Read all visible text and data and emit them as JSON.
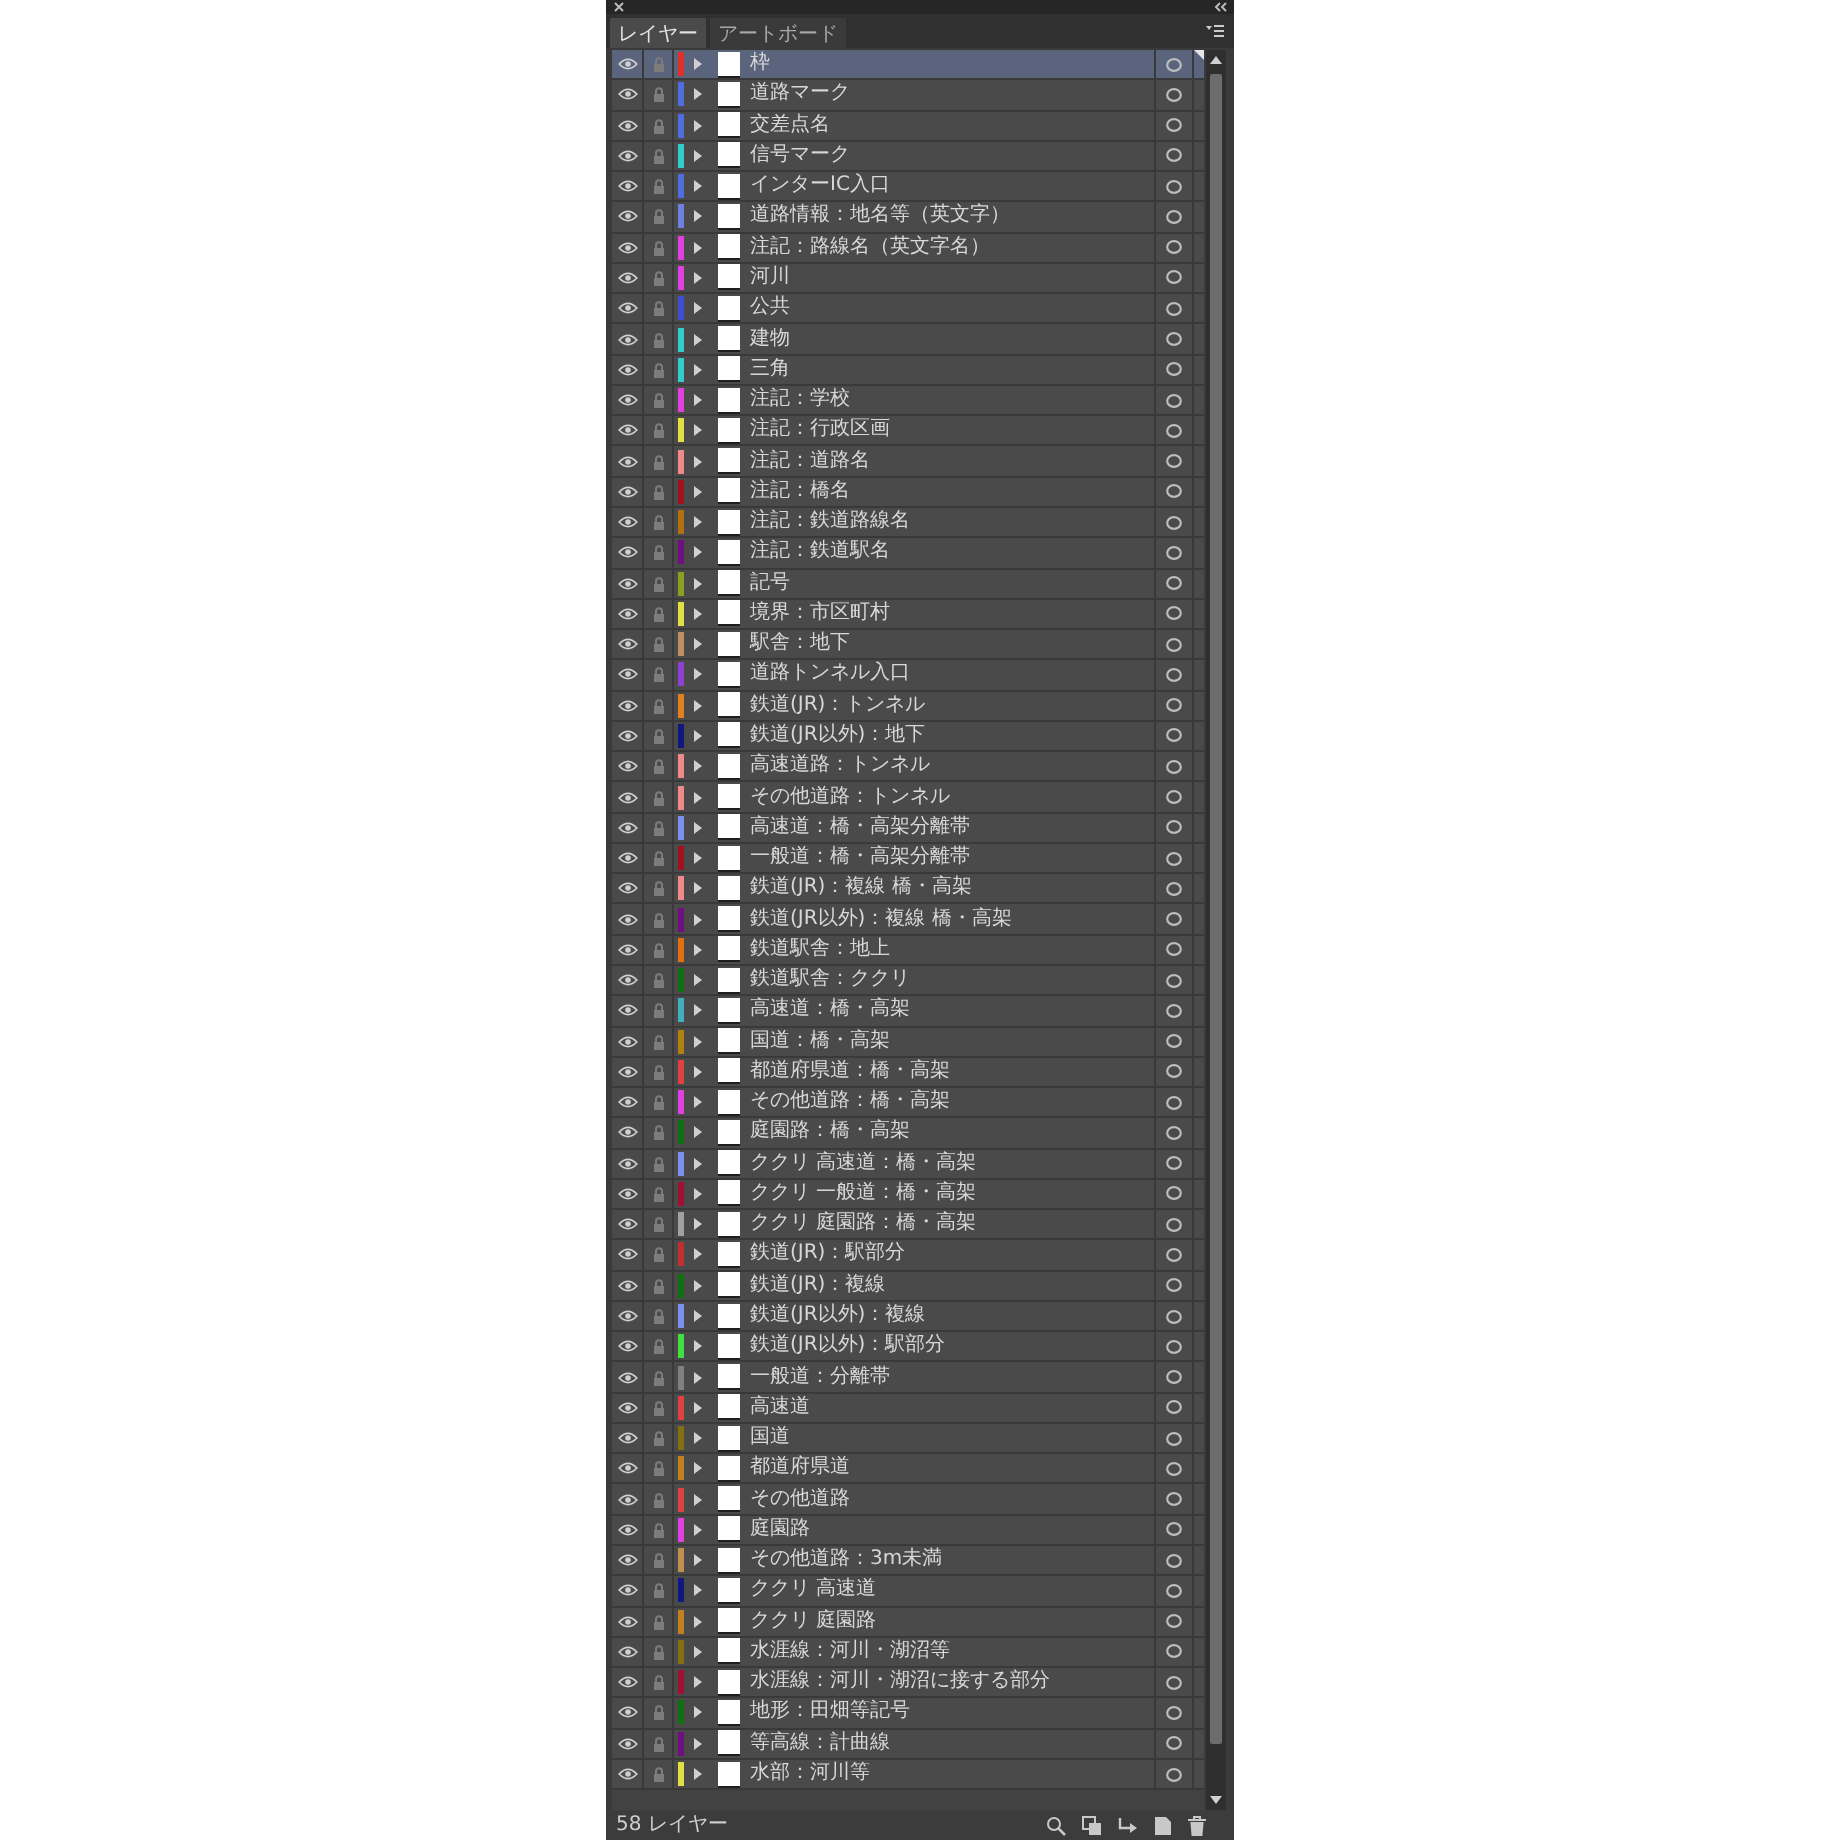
{
  "tabs": [
    {
      "label": "レイヤー",
      "selected": true
    },
    {
      "label": "アートボード",
      "selected": false
    }
  ],
  "layers": [
    {
      "name": "枠",
      "color": "#e0302c",
      "selected": true,
      "visible": true,
      "locked": true,
      "expanded": false
    },
    {
      "name": "道路マーク",
      "color": "#4f6ee0",
      "selected": false,
      "visible": true,
      "locked": true,
      "expanded": false
    },
    {
      "name": "交差点名",
      "color": "#4f6ee0",
      "selected": false,
      "visible": true,
      "locked": true,
      "expanded": false
    },
    {
      "name": "信号マーク",
      "color": "#33cccc",
      "selected": false,
      "visible": true,
      "locked": true,
      "expanded": false
    },
    {
      "name": "インターIC入口",
      "color": "#4f6ee0",
      "selected": false,
      "visible": true,
      "locked": true,
      "expanded": false
    },
    {
      "name": "道路情報：地名等（英文字）",
      "color": "#7080e0",
      "selected": false,
      "visible": true,
      "locked": true,
      "expanded": false
    },
    {
      "name": "注記：路線名（英文字名）",
      "color": "#e040e0",
      "selected": false,
      "visible": true,
      "locked": true,
      "expanded": false
    },
    {
      "name": "河川",
      "color": "#e040e0",
      "selected": false,
      "visible": true,
      "locked": true,
      "expanded": false
    },
    {
      "name": "公共",
      "color": "#3d4ed0",
      "selected": false,
      "visible": true,
      "locked": true,
      "expanded": false
    },
    {
      "name": "建物",
      "color": "#33cccc",
      "selected": false,
      "visible": true,
      "locked": true,
      "expanded": false
    },
    {
      "name": "三角",
      "color": "#33cccc",
      "selected": false,
      "visible": true,
      "locked": true,
      "expanded": false
    },
    {
      "name": "注記：学校",
      "color": "#e040e0",
      "selected": false,
      "visible": true,
      "locked": true,
      "expanded": false
    },
    {
      "name": "注記：行政区画",
      "color": "#e0e040",
      "selected": false,
      "visible": true,
      "locked": true,
      "expanded": false
    },
    {
      "name": "注記：道路名",
      "color": "#f08a8a",
      "selected": false,
      "visible": true,
      "locked": true,
      "expanded": false
    },
    {
      "name": "注記：橋名",
      "color": "#a01020",
      "selected": false,
      "visible": true,
      "locked": true,
      "expanded": false
    },
    {
      "name": "注記：鉄道路線名",
      "color": "#b07010",
      "selected": false,
      "visible": true,
      "locked": true,
      "expanded": false
    },
    {
      "name": "注記：鉄道駅名",
      "color": "#701080",
      "selected": false,
      "visible": true,
      "locked": true,
      "expanded": false
    },
    {
      "name": "記号",
      "color": "#8aa020",
      "selected": false,
      "visible": true,
      "locked": true,
      "expanded": false
    },
    {
      "name": "境界：市区町村",
      "color": "#e0e040",
      "selected": false,
      "visible": true,
      "locked": true,
      "expanded": false
    },
    {
      "name": "駅舎：地下",
      "color": "#c09060",
      "selected": false,
      "visible": true,
      "locked": true,
      "expanded": false
    },
    {
      "name": "道路トンネル入口",
      "color": "#9040d0",
      "selected": false,
      "visible": true,
      "locked": true,
      "expanded": false
    },
    {
      "name": "鉄道(JR)：トンネル",
      "color": "#e08020",
      "selected": false,
      "visible": true,
      "locked": true,
      "expanded": false
    },
    {
      "name": "鉄道(JR以外)：地下",
      "color": "#101880",
      "selected": false,
      "visible": true,
      "locked": true,
      "expanded": false
    },
    {
      "name": "高速道路：トンネル",
      "color": "#f08a8a",
      "selected": false,
      "visible": true,
      "locked": true,
      "expanded": false
    },
    {
      "name": "その他道路：トンネル",
      "color": "#f08a8a",
      "selected": false,
      "visible": true,
      "locked": true,
      "expanded": false
    },
    {
      "name": "高速道：橋・高架分離帯",
      "color": "#7f8ff0",
      "selected": false,
      "visible": true,
      "locked": true,
      "expanded": false
    },
    {
      "name": "一般道：橋・高架分離帯",
      "color": "#a01020",
      "selected": false,
      "visible": true,
      "locked": true,
      "expanded": false
    },
    {
      "name": "鉄道(JR)：複線 橋・高架",
      "color": "#f08a8a",
      "selected": false,
      "visible": true,
      "locked": true,
      "expanded": false
    },
    {
      "name": "鉄道(JR以外)：複線 橋・高架",
      "color": "#701080",
      "selected": false,
      "visible": true,
      "locked": true,
      "expanded": false
    },
    {
      "name": "鉄道駅舎：地上",
      "color": "#e07010",
      "selected": false,
      "visible": true,
      "locked": true,
      "expanded": false
    },
    {
      "name": "鉄道駅舎：ククリ",
      "color": "#107010",
      "selected": false,
      "visible": true,
      "locked": true,
      "expanded": false
    },
    {
      "name": "高速道：橋・高架",
      "color": "#40b0c0",
      "selected": false,
      "visible": true,
      "locked": true,
      "expanded": false
    },
    {
      "name": "国道：橋・高架",
      "color": "#b08010",
      "selected": false,
      "visible": true,
      "locked": true,
      "expanded": false
    },
    {
      "name": "都道府県道：橋・高架",
      "color": "#e04040",
      "selected": false,
      "visible": true,
      "locked": true,
      "expanded": false
    },
    {
      "name": "その他道路：橋・高架",
      "color": "#e040e0",
      "selected": false,
      "visible": true,
      "locked": true,
      "expanded": false
    },
    {
      "name": "庭園路：橋・高架",
      "color": "#107010",
      "selected": false,
      "visible": true,
      "locked": true,
      "expanded": false
    },
    {
      "name": "ククリ 高速道：橋・高架",
      "color": "#7f8ff0",
      "selected": false,
      "visible": true,
      "locked": true,
      "expanded": false
    },
    {
      "name": "ククリ 一般道：橋・高架",
      "color": "#a01030",
      "selected": false,
      "visible": true,
      "locked": true,
      "expanded": false
    },
    {
      "name": "ククリ 庭園路：橋・高架",
      "color": "#a0a0a0",
      "selected": false,
      "visible": true,
      "locked": true,
      "expanded": false
    },
    {
      "name": "鉄道(JR)：駅部分",
      "color": "#c03030",
      "selected": false,
      "visible": true,
      "locked": true,
      "expanded": false
    },
    {
      "name": "鉄道(JR)：複線",
      "color": "#107010",
      "selected": false,
      "visible": true,
      "locked": true,
      "expanded": false
    },
    {
      "name": "鉄道(JR以外)：複線",
      "color": "#7f8ff0",
      "selected": false,
      "visible": true,
      "locked": true,
      "expanded": false
    },
    {
      "name": "鉄道(JR以外)：駅部分",
      "color": "#40e040",
      "selected": false,
      "visible": true,
      "locked": true,
      "expanded": false
    },
    {
      "name": "一般道：分離帯",
      "color": "#808080",
      "selected": false,
      "visible": true,
      "locked": true,
      "expanded": false
    },
    {
      "name": "高速道",
      "color": "#e04040",
      "selected": false,
      "visible": true,
      "locked": true,
      "expanded": false
    },
    {
      "name": "国道",
      "color": "#807010",
      "selected": false,
      "visible": true,
      "locked": true,
      "expanded": false
    },
    {
      "name": "都道府県道",
      "color": "#c08020",
      "selected": false,
      "visible": true,
      "locked": true,
      "expanded": false
    },
    {
      "name": "その他道路",
      "color": "#e04040",
      "selected": false,
      "visible": true,
      "locked": true,
      "expanded": false
    },
    {
      "name": "庭園路",
      "color": "#e040e0",
      "selected": false,
      "visible": true,
      "locked": true,
      "expanded": false
    },
    {
      "name": "その他道路：3m未満",
      "color": "#c09050",
      "selected": false,
      "visible": true,
      "locked": true,
      "expanded": false
    },
    {
      "name": "ククリ 高速道",
      "color": "#101880",
      "selected": false,
      "visible": true,
      "locked": true,
      "expanded": false
    },
    {
      "name": "ククリ 庭園路",
      "color": "#c08020",
      "selected": false,
      "visible": true,
      "locked": true,
      "expanded": false
    },
    {
      "name": "水涯線：河川・湖沼等",
      "color": "#807010",
      "selected": false,
      "visible": true,
      "locked": true,
      "expanded": false
    },
    {
      "name": "水涯線：河川・湖沼に接する部分",
      "color": "#a01030",
      "selected": false,
      "visible": true,
      "locked": true,
      "expanded": false
    },
    {
      "name": "地形：田畑等記号",
      "color": "#107010",
      "selected": false,
      "visible": true,
      "locked": true,
      "expanded": false
    },
    {
      "name": "等高線：計曲線",
      "color": "#701080",
      "selected": false,
      "visible": true,
      "locked": true,
      "expanded": false
    },
    {
      "name": "水部：河川等",
      "color": "#e0e040",
      "selected": false,
      "visible": true,
      "locked": true,
      "expanded": false
    }
  ],
  "footer": {
    "layer_count": "58 レイヤー"
  }
}
